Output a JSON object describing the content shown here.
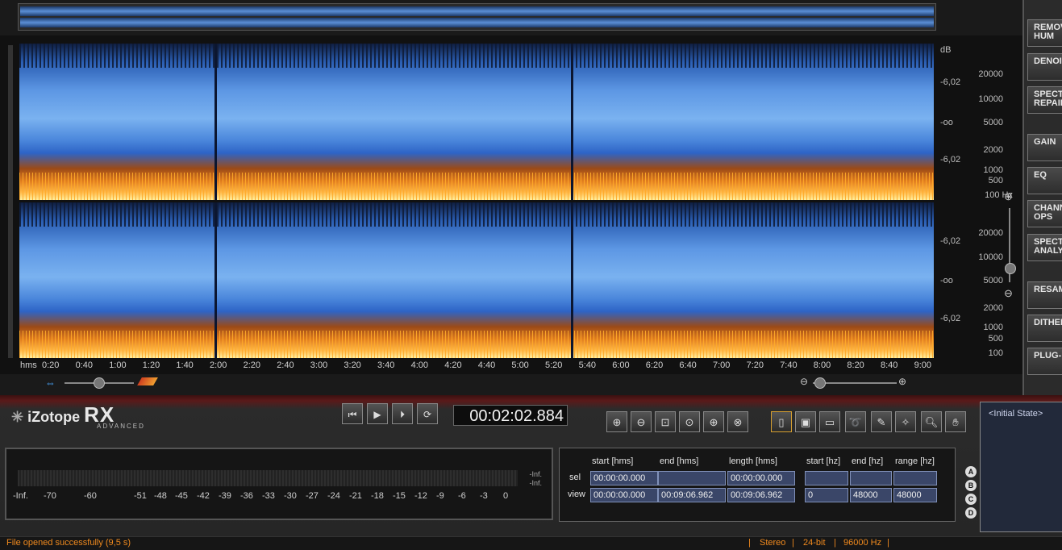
{
  "app": {
    "brand": "iZotope",
    "product": "RX",
    "edition": "ADVANCED"
  },
  "modules": [
    "REMOVE\nHUM",
    "DENOISE",
    "SPECTRAL\nREPAIR",
    "GAIN",
    "EQ",
    "CHANNEL\nOPS",
    "SPECTRUM\nANALYZER",
    "RESAMPLE",
    "DITHER",
    "PLUG-IN"
  ],
  "scale": {
    "db_unit": "dB",
    "db_labels": [
      "-6,02",
      "-oo",
      "-6,02"
    ],
    "hz_labels": [
      "20000",
      "10000",
      "5000",
      "2000",
      "1000",
      "500",
      "100 Hz"
    ],
    "hz_labels_bottom": [
      "20000",
      "10000",
      "5000",
      "2000",
      "1000",
      "500",
      "100"
    ]
  },
  "timeline": {
    "unit": "hms",
    "ticks": [
      "0:20",
      "0:40",
      "1:00",
      "1:20",
      "1:40",
      "2:00",
      "2:20",
      "2:40",
      "3:00",
      "3:20",
      "3:40",
      "4:00",
      "4:20",
      "4:40",
      "5:00",
      "5:20",
      "5:40",
      "6:00",
      "6:20",
      "6:40",
      "7:00",
      "7:20",
      "7:40",
      "8:00",
      "8:20",
      "8:40",
      "9:00"
    ]
  },
  "transport": {
    "timecode": "00:02:02.884"
  },
  "undo_history": {
    "initial": "<Initial State>"
  },
  "meter": {
    "inf_top": "-Inf.",
    "inf_bottom": "-Inf.",
    "ticks": [
      "-Inf.",
      "-70",
      "-60",
      "-51",
      "-48",
      "-45",
      "-42",
      "-39",
      "-36",
      "-33",
      "-30",
      "-27",
      "-24",
      "-21",
      "-18",
      "-15",
      "-12",
      "-9",
      "-6",
      "-3",
      "0"
    ]
  },
  "selection": {
    "headers": [
      "start [hms]",
      "end [hms]",
      "length [hms]",
      "start [hz]",
      "end [hz]",
      "range [hz]"
    ],
    "rows": [
      {
        "label": "sel",
        "values": [
          "00:00:00.000",
          "",
          "00:00:00.000",
          "",
          "",
          ""
        ]
      },
      {
        "label": "view",
        "values": [
          "00:00:00.000",
          "00:09:06.962",
          "00:09:06.962",
          "0",
          "48000",
          "48000"
        ]
      }
    ],
    "snapshots": [
      "A",
      "B",
      "C",
      "D"
    ]
  },
  "status": {
    "message": "File opened successfully (9,5 s)",
    "channels": "Stereo",
    "bitdepth": "24-bit",
    "samplerate": "96000 Hz"
  }
}
